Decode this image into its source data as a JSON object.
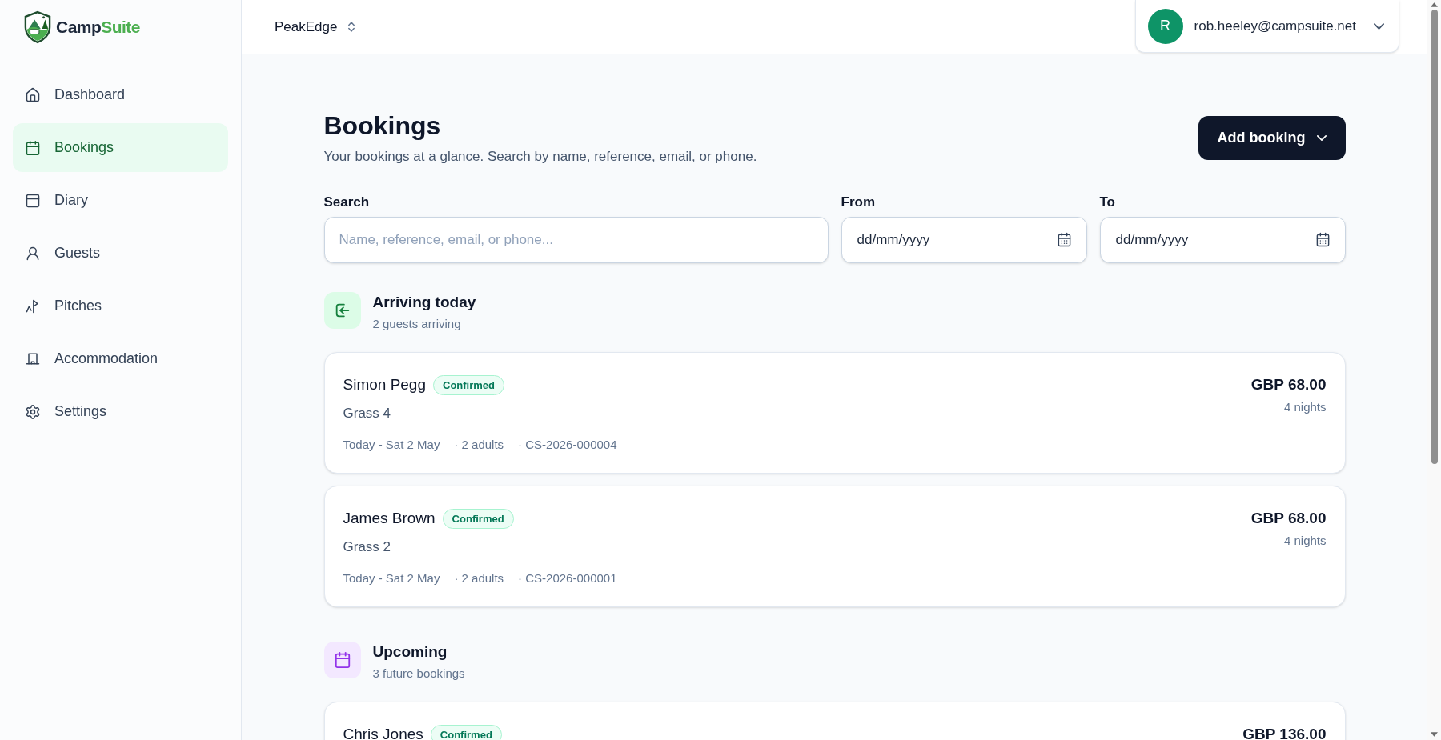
{
  "brand": {
    "name_start": "Camp",
    "name_end": "Suite"
  },
  "workspace": {
    "name": "PeakEdge"
  },
  "user": {
    "initial": "R",
    "email": "rob.heeley@campsuite.net"
  },
  "sidebar": {
    "items": [
      {
        "label": "Dashboard",
        "selected": false
      },
      {
        "label": "Bookings",
        "selected": true
      },
      {
        "label": "Diary",
        "selected": false
      },
      {
        "label": "Guests",
        "selected": false
      },
      {
        "label": "Pitches",
        "selected": false
      },
      {
        "label": "Accommodation",
        "selected": false
      },
      {
        "label": "Settings",
        "selected": false
      }
    ]
  },
  "page": {
    "title": "Bookings",
    "subtitle": "Your bookings at a glance. Search by name, reference, email, or phone.",
    "primary_action": "Add booking"
  },
  "filters": {
    "search": {
      "label": "Search",
      "placeholder": "Name, reference, email, or phone..."
    },
    "from": {
      "label": "From",
      "placeholder": "dd/mm/yyyy"
    },
    "to": {
      "label": "To",
      "placeholder": "dd/mm/yyyy"
    }
  },
  "sections": [
    {
      "kind": "arriving",
      "title": "Arriving today",
      "subtitle": "2 guests arriving",
      "bookings": [
        {
          "guest": "Simon Pegg",
          "status": "Confirmed",
          "pitch": "Grass 4",
          "dates": "Today - Sat 2 May",
          "party": "· 2 adults",
          "reference": "· CS-2026-000004",
          "price": "GBP 68.00",
          "nights": "4 nights"
        },
        {
          "guest": "James Brown",
          "status": "Confirmed",
          "pitch": "Grass 2",
          "dates": "Today - Sat 2 May",
          "party": "· 2 adults",
          "reference": "· CS-2026-000001",
          "price": "GBP 68.00",
          "nights": "4 nights"
        }
      ]
    },
    {
      "kind": "upcoming",
      "title": "Upcoming",
      "subtitle": "3 future bookings",
      "bookings": [
        {
          "guest": "Chris Jones",
          "status": "Confirmed",
          "price": "GBP 136.00"
        }
      ]
    }
  ]
}
